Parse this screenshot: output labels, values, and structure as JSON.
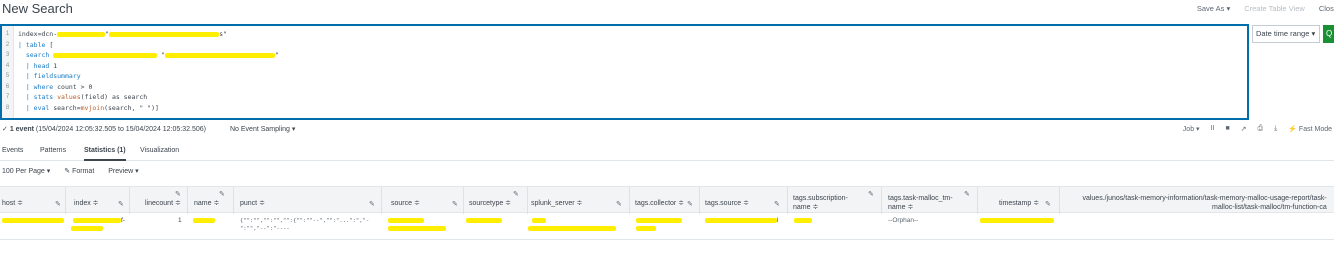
{
  "header": {
    "title": "New Search",
    "save_as": "Save As ▾",
    "create_table_view": "Create Table View",
    "close": "Close"
  },
  "editor": {
    "line_numbers": [
      "1",
      "2",
      "3",
      "4",
      "5",
      "6",
      "7",
      "8"
    ],
    "lines": [
      {
        "plain": "index=dcn-",
        "after": "\""
      },
      {
        "kw": "| table",
        "rest": " ["
      },
      {
        "kw": "search",
        "rest": " "
      },
      {
        "kw": "| head",
        "rest": " 1"
      },
      {
        "kw": "| fieldsummary",
        "rest": ""
      },
      {
        "kw": "| where",
        "rest": " count > 0"
      },
      {
        "kw": "| stats",
        "fn": " values",
        "rest": "(field) as search"
      },
      {
        "kw": "| eval",
        "rest": " search=",
        "fn2": "mvjoin",
        "rest2": "(search, \" \")]"
      }
    ]
  },
  "time_range": "Date time range ▾",
  "search_button": "Q",
  "status": {
    "events_check": "✓",
    "events_count": "1 event",
    "events_range": " (15/04/2024 12:05:32.505 to 15/04/2024 12:05:32.506)",
    "sampling": "No Event Sampling ▾",
    "job": "Job ▾",
    "pause": "II",
    "stop": "■",
    "share": "↗",
    "print": "⎙",
    "export": "⤓",
    "mode": "⚡ Fast Mode"
  },
  "tabs": [
    {
      "label": "Events",
      "active": false
    },
    {
      "label": "Patterns",
      "active": false
    },
    {
      "label": "Statistics (1)",
      "active": true
    },
    {
      "label": "Visualization",
      "active": false
    }
  ],
  "toolbar": {
    "per_page": "100 Per Page ▾",
    "format": "✎ Format",
    "preview": "Preview ▾"
  },
  "table": {
    "columns": [
      {
        "label": "host ≑"
      },
      {
        "label": "index ≑"
      },
      {
        "label": "linecount ≑"
      },
      {
        "label": "name ≑"
      },
      {
        "label": "punct ≑"
      },
      {
        "label": "source ≑"
      },
      {
        "label": "sourcetype ≑"
      },
      {
        "label": "splunk_server ≑"
      },
      {
        "label": "tags.collector ≑"
      },
      {
        "label": "tags.source ≑"
      },
      {
        "label1": "tags.subscription-",
        "label2": "name ≑"
      },
      {
        "label1": "tags.task-malloc_tm-",
        "label2": "name ≑"
      },
      {
        "label": "timestamp ≑"
      },
      {
        "label1": "values./junos/task-memory-information/task-memory-malloc-usage-report/task-",
        "label2": "malloc-list/task-malloc/tm-function-ca"
      }
    ],
    "row": {
      "linecount": "1",
      "punct_line1": "{\"\":\"\",\"\":\"\",\"\":{\"\":\"\"--\",\"\":\"...\":\",\"-",
      "punct_line2": "\":\"\",\"--\":\"----",
      "index_suffix": "f-",
      "tags_source_suffix": "l",
      "task_malloc_name": "--Orphan--"
    }
  }
}
